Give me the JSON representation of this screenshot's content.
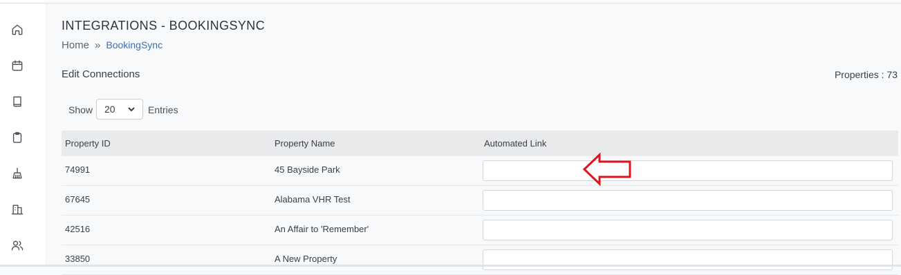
{
  "sidebar": {
    "items": [
      {
        "name": "home"
      },
      {
        "name": "calendar"
      },
      {
        "name": "book"
      },
      {
        "name": "clipboard"
      },
      {
        "name": "cleaning"
      },
      {
        "name": "building"
      },
      {
        "name": "users"
      }
    ]
  },
  "header": {
    "title": "INTEGRATIONS - BOOKINGSYNC",
    "breadcrumb": {
      "home": "Home",
      "separator": "»",
      "current": "BookingSync"
    }
  },
  "section": {
    "title": "Edit Connections",
    "properties_count": "Properties : 73"
  },
  "entries": {
    "show_label": "Show",
    "selected": "20",
    "entries_label": "Entries"
  },
  "table": {
    "columns": [
      "Property ID",
      "Property Name",
      "Automated Link"
    ],
    "rows": [
      {
        "id": "74991",
        "name": "45 Bayside Park",
        "link": ""
      },
      {
        "id": "67645",
        "name": "Alabama VHR Test",
        "link": ""
      },
      {
        "id": "42516",
        "name": "An Affair to 'Remember'",
        "link": ""
      },
      {
        "id": "33850",
        "name": "A New Property",
        "link": ""
      }
    ]
  },
  "annotation": {
    "arrow_color": "#e0141c"
  },
  "colors": {
    "link": "#3b6fb6",
    "header_bg": "#e9eaeb",
    "page_bg": "#f8f9fa"
  }
}
